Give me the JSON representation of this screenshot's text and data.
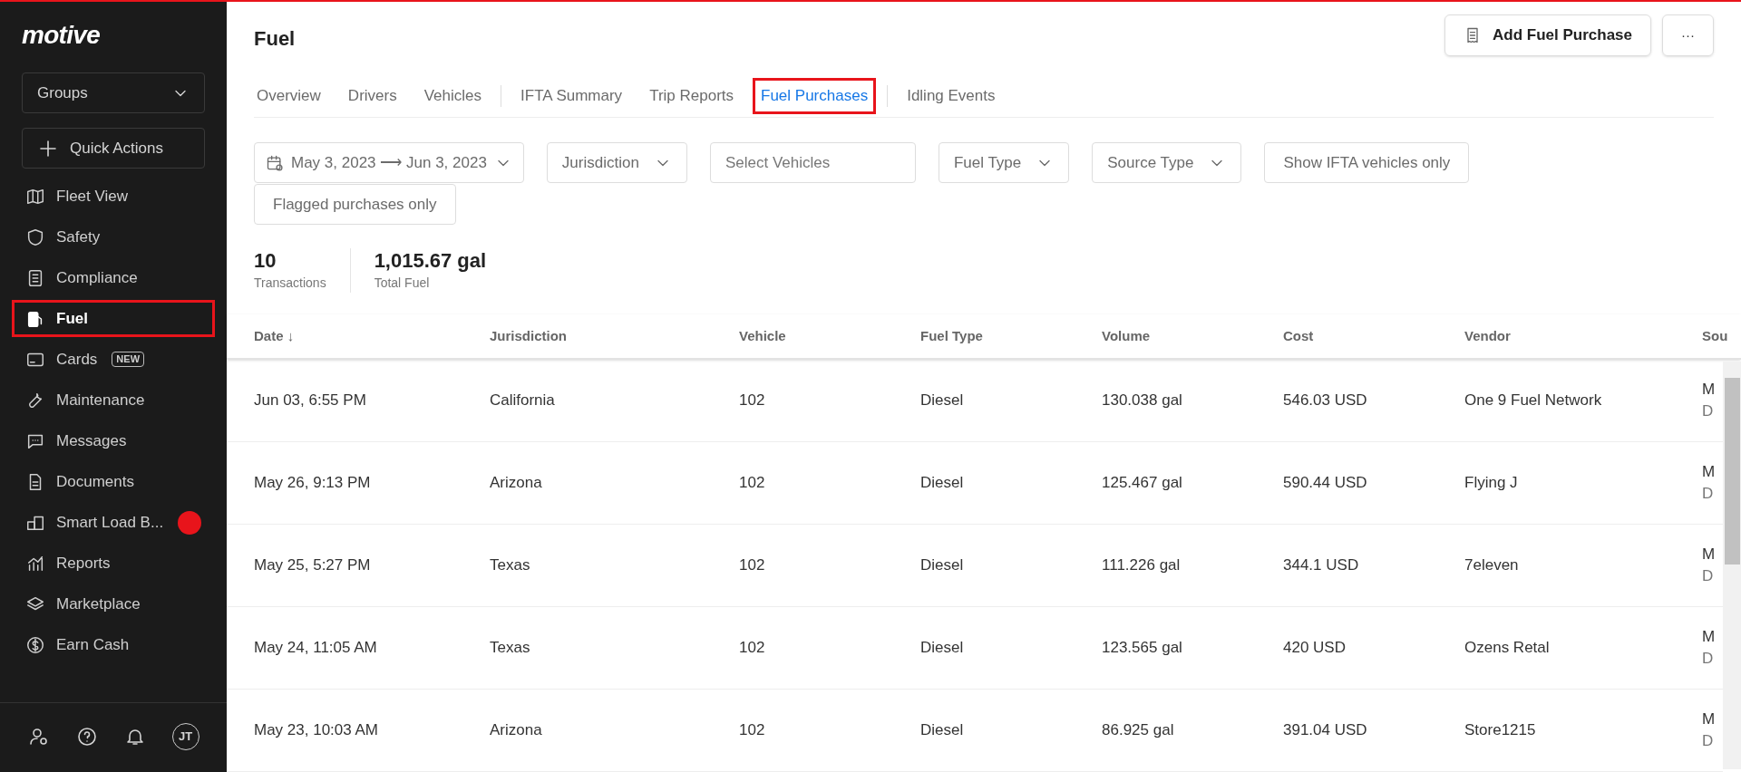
{
  "sidebar": {
    "logo": "motive",
    "groups": "Groups",
    "quick_actions": "Quick Actions",
    "items": [
      {
        "label": "Fleet View",
        "selected": false,
        "highlighted": false
      },
      {
        "label": "Safety",
        "selected": false,
        "highlighted": false
      },
      {
        "label": "Compliance",
        "selected": false,
        "highlighted": false
      },
      {
        "label": "Fuel",
        "selected": true,
        "highlighted": true
      },
      {
        "label": "Cards",
        "badge": "NEW",
        "selected": false,
        "highlighted": false
      },
      {
        "label": "Maintenance",
        "selected": false,
        "highlighted": false
      },
      {
        "label": "Messages",
        "selected": false,
        "highlighted": false
      },
      {
        "label": "Documents",
        "selected": false,
        "highlighted": false
      },
      {
        "label": "Smart Load B...",
        "dot": true,
        "selected": false,
        "highlighted": false
      },
      {
        "label": "Reports",
        "selected": false,
        "highlighted": false
      },
      {
        "label": "Marketplace",
        "selected": false,
        "highlighted": false
      },
      {
        "label": "Earn Cash",
        "selected": false,
        "highlighted": false
      }
    ],
    "avatar": "JT"
  },
  "header": {
    "title": "Fuel",
    "add_button": "Add Fuel Purchase",
    "more_button": "···"
  },
  "tabs": [
    {
      "label": "Overview",
      "selected": false,
      "highlighted": false,
      "divider_after": false
    },
    {
      "label": "Drivers",
      "selected": false,
      "highlighted": false,
      "divider_after": false
    },
    {
      "label": "Vehicles",
      "selected": false,
      "highlighted": false,
      "divider_after": true
    },
    {
      "label": "IFTA Summary",
      "selected": false,
      "highlighted": false,
      "divider_after": false
    },
    {
      "label": "Trip Reports",
      "selected": false,
      "highlighted": false,
      "divider_after": false
    },
    {
      "label": "Fuel Purchases",
      "selected": true,
      "highlighted": true,
      "divider_after": true
    },
    {
      "label": "Idling Events",
      "selected": false,
      "highlighted": false,
      "divider_after": false
    }
  ],
  "filters": [
    {
      "kind": "daterange",
      "from": "May 3, 2023",
      "arrow": "⟶",
      "to": "Jun 3, 2023"
    },
    {
      "kind": "dropdown",
      "label": "Jurisdiction"
    },
    {
      "kind": "input",
      "placeholder": "Select Vehicles"
    },
    {
      "kind": "dropdown",
      "label": "Fuel Type"
    },
    {
      "kind": "dropdown",
      "label": "Source Type"
    },
    {
      "kind": "toggle",
      "label": "Show IFTA vehicles only"
    },
    {
      "kind": "toggle",
      "label": "Flagged purchases only"
    }
  ],
  "stats": [
    {
      "value": "10",
      "label": "Transactions"
    },
    {
      "value": "1,015.67 gal",
      "label": "Total Fuel"
    }
  ],
  "table": {
    "columns": [
      "Date ↓",
      "Jurisdiction",
      "Vehicle",
      "Fuel Type",
      "Volume",
      "Cost",
      "Vendor",
      "Sou"
    ],
    "rows": [
      [
        "Jun 03, 6:55 PM",
        "California",
        "102",
        "Diesel",
        "130.038 gal",
        "546.03 USD",
        "One 9 Fuel Network",
        "M",
        "D"
      ],
      [
        "May 26, 9:13 PM",
        "Arizona",
        "102",
        "Diesel",
        "125.467 gal",
        "590.44 USD",
        "Flying J",
        "M",
        "D"
      ],
      [
        "May 25, 5:27 PM",
        "Texas",
        "102",
        "Diesel",
        "111.226 gal",
        "344.1 USD",
        "7eleven",
        "M",
        "D"
      ],
      [
        "May 24, 11:05 AM",
        "Texas",
        "102",
        "Diesel",
        "123.565 gal",
        "420 USD",
        "Ozens Retal",
        "M",
        "D"
      ],
      [
        "May 23, 10:03 AM",
        "Arizona",
        "102",
        "Diesel",
        "86.925 gal",
        "391.04 USD",
        "Store1215",
        "M",
        "D"
      ]
    ]
  }
}
